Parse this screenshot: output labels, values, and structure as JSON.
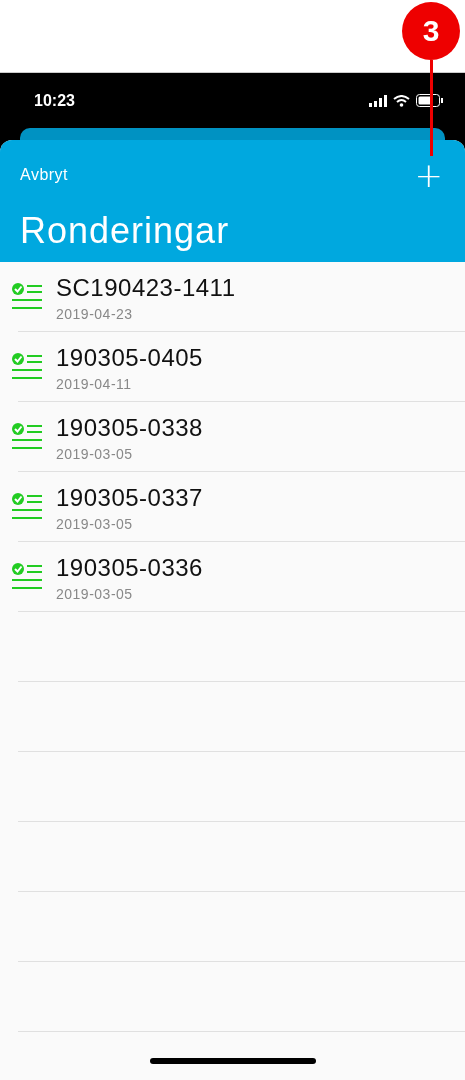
{
  "callout": {
    "number": "3"
  },
  "status_bar": {
    "time": "10:23"
  },
  "header": {
    "cancel": "Avbryt",
    "add": "+",
    "title": "Ronderingar"
  },
  "items": [
    {
      "title": "SC190423-1411",
      "date": "2019-04-23",
      "done": true
    },
    {
      "title": "190305-0405",
      "date": "2019-04-11",
      "done": true
    },
    {
      "title": "190305-0338",
      "date": "2019-03-05",
      "done": true
    },
    {
      "title": "190305-0337",
      "date": "2019-03-05",
      "done": true
    },
    {
      "title": "190305-0336",
      "date": "2019-03-05",
      "done": true
    }
  ]
}
